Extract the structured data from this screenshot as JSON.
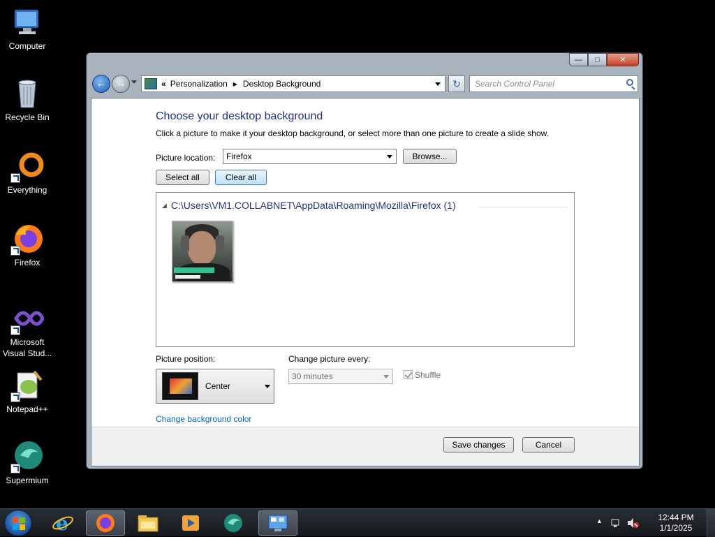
{
  "desktop": {
    "icons": [
      {
        "label": "Computer"
      },
      {
        "label": "Recycle Bin"
      },
      {
        "label": "Everything"
      },
      {
        "label": "Firefox"
      },
      {
        "label": "Microsoft Visual Stud..."
      },
      {
        "label": "Notepad++"
      },
      {
        "label": "Supermium"
      }
    ]
  },
  "window": {
    "address": {
      "overflow_chevron": "«",
      "crumbs": [
        "Personalization",
        "Desktop Background"
      ]
    },
    "search": {
      "placeholder": "Search Control Panel"
    },
    "heading": "Choose your desktop background",
    "description": "Click a picture to make it your desktop background, or select more than one picture to create a slide show.",
    "picture_location": {
      "label": "Picture location:",
      "value": "Firefox",
      "browse_label": "Browse..."
    },
    "select_all_label": "Select all",
    "clear_all_label": "Clear all",
    "group": {
      "title": "C:\\Users\\VM1.COLLABNET\\AppData\\Roaming\\Mozilla\\Firefox (1)"
    },
    "picture_position": {
      "label": "Picture position:",
      "value": "Center"
    },
    "change_picture": {
      "label": "Change picture every:",
      "value": "30 minutes"
    },
    "shuffle_label": "Shuffle",
    "bg_color_link": "Change background color",
    "save_label": "Save changes",
    "cancel_label": "Cancel"
  },
  "taskbar": {
    "clock": {
      "time": "12:44 PM",
      "date": "1/1/2025"
    }
  },
  "colors": {
    "heading": "#1e3287",
    "link": "#0066cc",
    "accent": "#3c7fb1"
  }
}
